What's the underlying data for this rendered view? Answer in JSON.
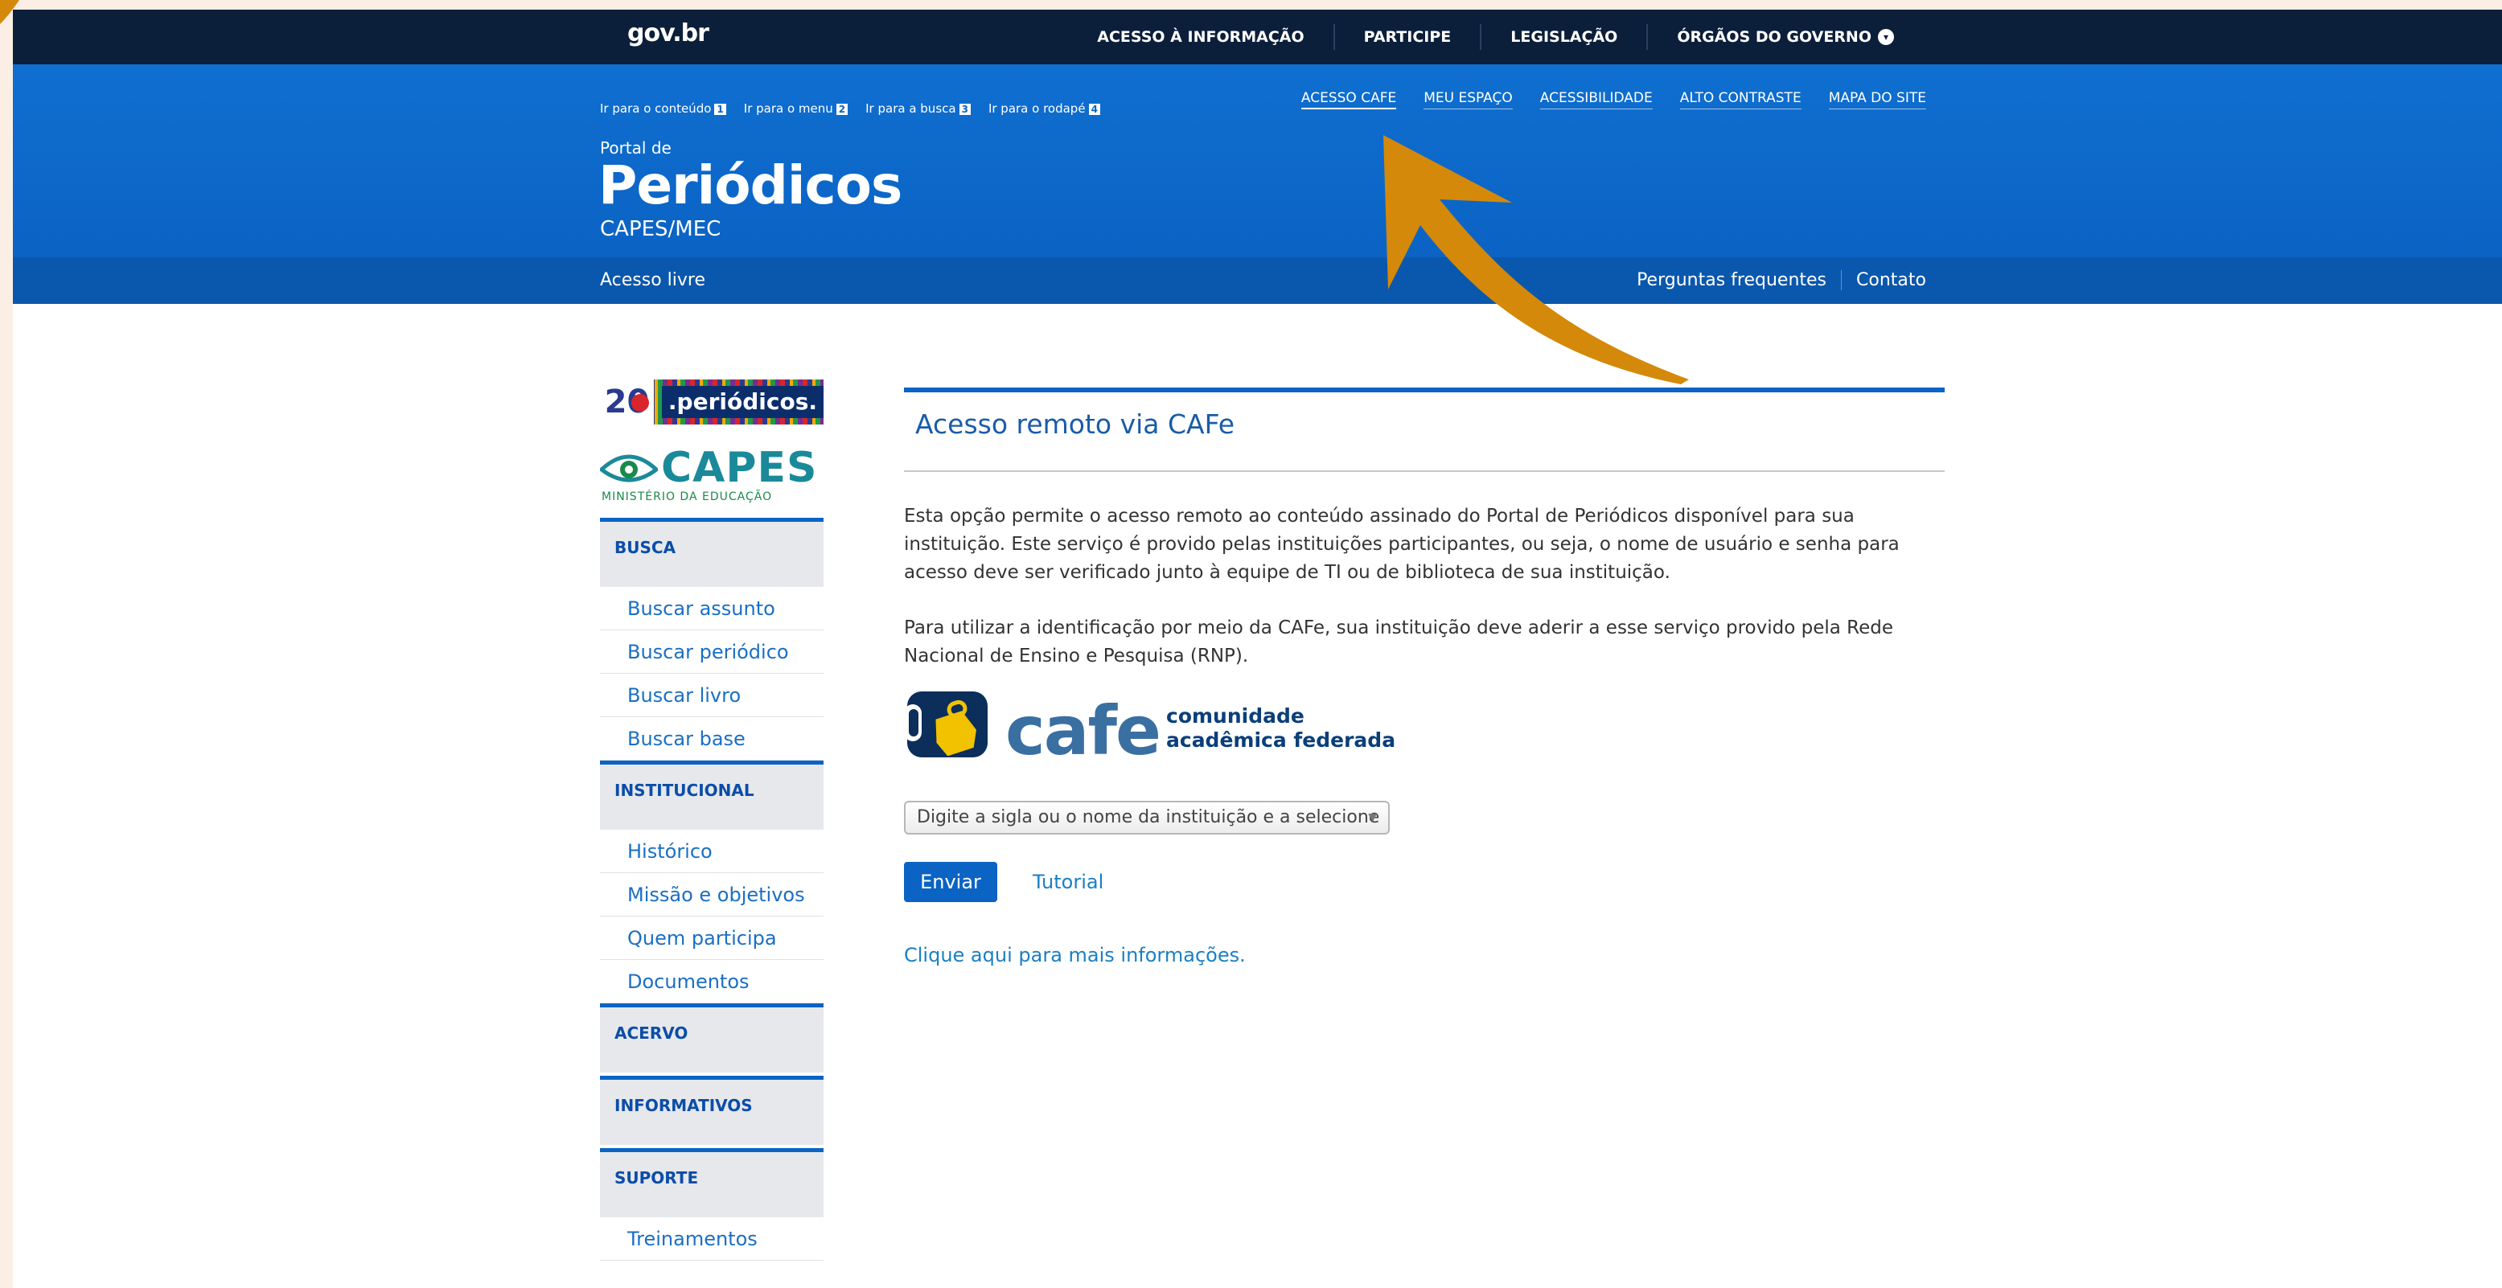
{
  "govbar": {
    "logo": "gov.br",
    "nav": [
      "ACESSO À INFORMAÇÃO",
      "PARTICIPE",
      "LEGISLAÇÃO",
      "ÓRGÃOS DO GOVERNO"
    ]
  },
  "header": {
    "skip_links": [
      {
        "label": "Ir para o conteúdo",
        "key": "1"
      },
      {
        "label": "Ir para o menu",
        "key": "2"
      },
      {
        "label": "Ir para a busca",
        "key": "3"
      },
      {
        "label": "Ir para o rodapé",
        "key": "4"
      }
    ],
    "top_links": [
      "ACESSO CAFE",
      "MEU ESPAÇO",
      "ACESSIBILIDADE",
      "ALTO CONTRASTE",
      "MAPA DO SITE"
    ],
    "portal_de": "Portal de",
    "title": "Periódicos",
    "subtitle": "CAPES/MEC",
    "subbar_left": "Acesso livre",
    "subbar_right": [
      "Perguntas frequentes",
      "Contato"
    ]
  },
  "sidebar": {
    "banner_num": "20",
    "banner_text": ".periódicos.",
    "capes_word": "CAPES",
    "capes_ministry": "MINISTÉRIO DA EDUCAÇÃO",
    "sections": [
      {
        "title": "BUSCA",
        "items": [
          "Buscar assunto",
          "Buscar periódico",
          "Buscar livro",
          "Buscar base"
        ]
      },
      {
        "title": "INSTITUCIONAL",
        "items": [
          "Histórico",
          "Missão e objetivos",
          "Quem participa",
          "Documentos"
        ]
      },
      {
        "title": "ACERVO",
        "items": []
      },
      {
        "title": "INFORMATIVOS",
        "items": []
      },
      {
        "title": "SUPORTE",
        "items": [
          "Treinamentos"
        ]
      }
    ]
  },
  "main": {
    "heading": "Acesso remoto via CAFe",
    "para1": "Esta opção permite o acesso remoto ao conteúdo assinado do Portal de Periódicos disponível para sua instituição. Este serviço é provido pelas instituições participantes, ou seja, o nome de usuário e senha para acesso deve ser verificado junto à equipe de TI ou de biblioteca de sua instituição.",
    "para2": "Para utilizar a identificação por meio da CAFe, sua instituição deve aderir a esse serviço provido pela Rede Nacional de Ensino e Pesquisa (RNP).",
    "cafe_word": "cafe",
    "cafe_tag1": "comunidade",
    "cafe_tag2": "acadêmica federada",
    "select_placeholder": "Digite a sigla ou o nome da instituição e a selecione",
    "submit_label": "Enviar",
    "tutorial_label": "Tutorial",
    "more_info": "Clique aqui para mais informações."
  },
  "colors": {
    "govbar": "#0c1f3a",
    "header_blue": "#0b63c4",
    "arrow": "#d4890a"
  }
}
